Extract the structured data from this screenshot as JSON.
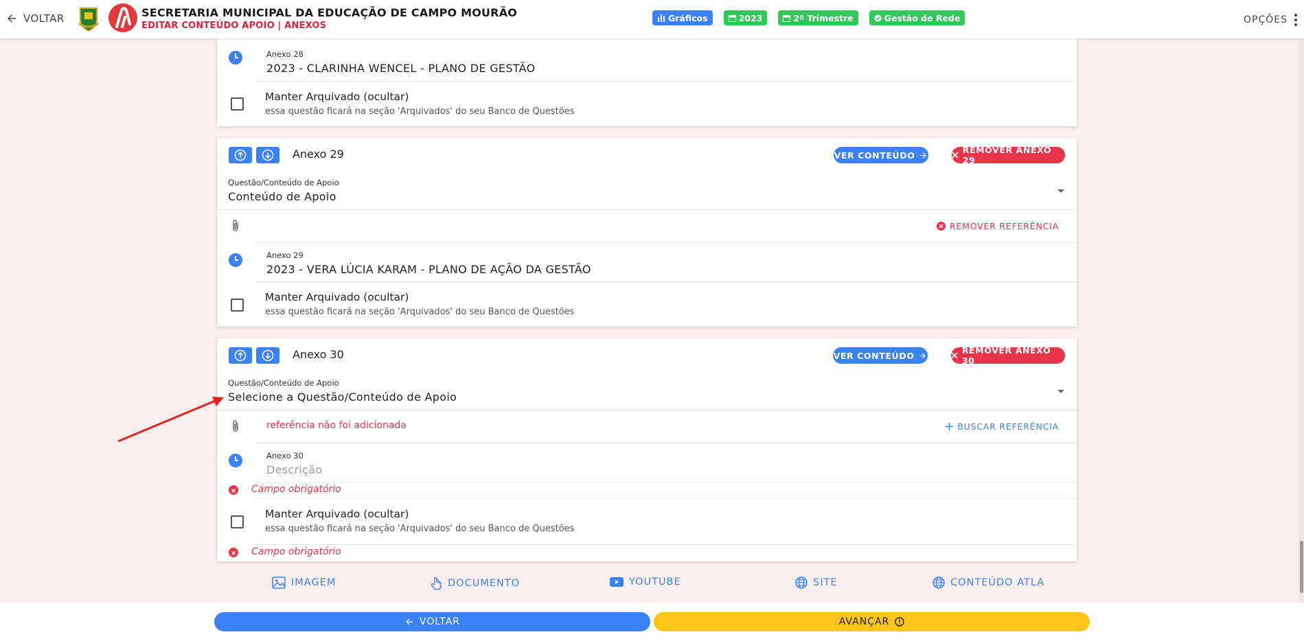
{
  "header": {
    "back_label": "VOLTAR",
    "title": "SECRETARIA MUNICIPAL DA EDUCAÇÃO DE CAMPO MOURÃO",
    "subtitle": "EDITAR CONTEÚDO APOIO | ANEXOS",
    "chips": [
      {
        "label": "Gráficos",
        "icon": "bar-chart-icon",
        "color": "#3b82f6"
      },
      {
        "label": "2023",
        "icon": "calendar-icon",
        "color": "#34c759"
      },
      {
        "label": "2º Trimestre",
        "icon": "calendar-icon",
        "color": "#34c759"
      },
      {
        "label": "Gestão de Rede",
        "icon": "check-circle-icon",
        "color": "#34c759"
      }
    ],
    "options_label": "OPÇÕES"
  },
  "annex28": {
    "desc_label": "Anexo 28",
    "desc_value": "2023 - CLARINHA WENCEL - PLANO DE GESTÃO",
    "archive_title": "Manter Arquivado (ocultar)",
    "archive_desc": "essa questão ficará na seção 'Arquivados' do seu Banco de Questões"
  },
  "annex29": {
    "title": "Anexo 29",
    "view_label": "VER CONTEÚDO",
    "remove_label": "REMOVER ANEXO 29",
    "select_label": "Questão/Conteúdo de Apoio",
    "select_value": "Conteúdo de Apoio",
    "ref_action": "REMOVER REFERÊNCIA",
    "desc_label": "Anexo 29",
    "desc_value": "2023 - VERA LÚCIA KARAM - PLANO DE AÇÃO DA GESTÃO",
    "archive_title": "Manter Arquivado (ocultar)",
    "archive_desc": "essa questão ficará na seção 'Arquivados' do seu Banco de Questões"
  },
  "annex30": {
    "title": "Anexo 30",
    "view_label": "VER CONTEÚDO",
    "remove_label": "REMOVER ANEXO 30",
    "select_label": "Questão/Conteúdo de Apoio",
    "select_placeholder": "Selecione a Questão/Conteúdo de Apoio",
    "ref_missing": "referência não foi adicionada",
    "ref_action": "BUSCAR REFERÊNCIA",
    "desc_label": "Anexo 30",
    "desc_placeholder": "Descrição",
    "error_text": "Campo obrigatório",
    "archive_title": "Manter Arquivado (ocultar)",
    "archive_desc": "essa questão ficará na seção 'Arquivados' do seu Banco de Questões",
    "error_text2": "Campo obrigatório"
  },
  "attachment_types": [
    {
      "label": "IMAGEM",
      "icon": "image-icon"
    },
    {
      "label": "DOCUMENTO",
      "icon": "hand-pointer-icon"
    },
    {
      "label": "YOUTUBE",
      "icon": "youtube-icon"
    },
    {
      "label": "SITE",
      "icon": "globe-icon"
    },
    {
      "label": "CONTEÚDO ATLA",
      "icon": "globe-icon"
    }
  ],
  "footer": {
    "back_label": "VOLTAR",
    "next_label": "AVANÇAR"
  },
  "colors": {
    "primary": "#3b82f6",
    "danger": "#e8354a",
    "success": "#34c759",
    "warning": "#fdc41a",
    "page_bg": "#fbeeee"
  }
}
